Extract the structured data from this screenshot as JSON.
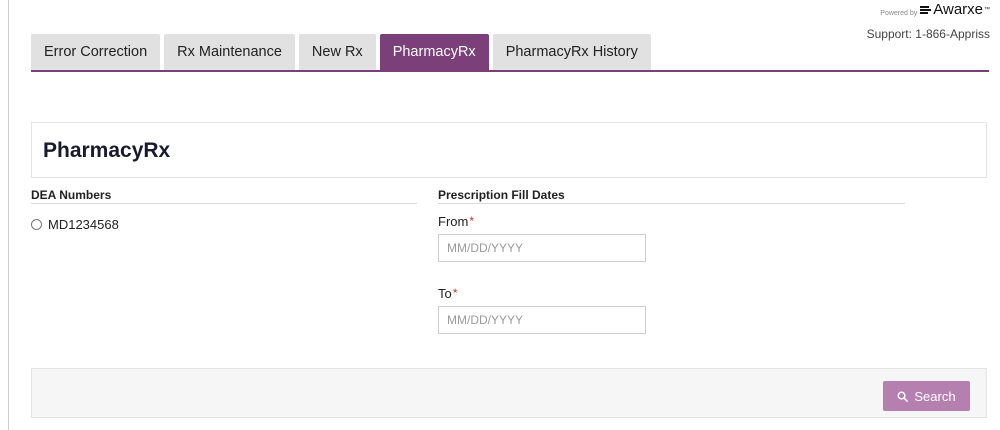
{
  "branding": {
    "powered_by": "Powered by",
    "logo_text": "Awarxe",
    "trademark": "™",
    "support": "Support: 1-866-Appriss"
  },
  "tabs": [
    {
      "label": "Error Correction",
      "active": false
    },
    {
      "label": "Rx Maintenance",
      "active": false
    },
    {
      "label": "New Rx",
      "active": false
    },
    {
      "label": "PharmacyRx",
      "active": true
    },
    {
      "label": "PharmacyRx History",
      "active": false
    }
  ],
  "page": {
    "title": "PharmacyRx"
  },
  "dea": {
    "heading": "DEA Numbers",
    "options": [
      {
        "label": "MD1234568",
        "selected": false
      }
    ]
  },
  "fill_dates": {
    "heading": "Prescription Fill Dates",
    "from_label": "From",
    "to_label": "To",
    "required_mark": "*",
    "from_placeholder": "MM/DD/YYYY",
    "to_placeholder": "MM/DD/YYYY",
    "from_value": "",
    "to_value": ""
  },
  "actions": {
    "search_label": "Search"
  },
  "colors": {
    "accent": "#7b3f79",
    "button": "#b57fb0",
    "required": "#c0392b"
  }
}
